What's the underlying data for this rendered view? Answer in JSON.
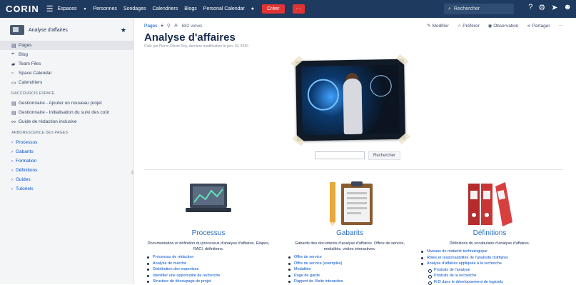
{
  "topbar": {
    "logo": "C RIN",
    "nav": [
      "Espaces",
      "Personnes",
      "Sondages",
      "Calendriers",
      "Blogs",
      "Personal Calendar"
    ],
    "create_label": "Créer",
    "more_label": "···",
    "search_placeholder": "Rechercher"
  },
  "sidebar": {
    "space_name": "Analyse d'affaires",
    "items": [
      {
        "label": "Pages",
        "icon": "page-icon"
      },
      {
        "label": "Blog",
        "icon": "quote-icon"
      },
      {
        "label": "Team Files",
        "icon": "folder-icon"
      },
      {
        "label": "Space Calendar",
        "icon": "calendar-icon"
      },
      {
        "label": "Calendriers",
        "icon": "calendar-icon"
      }
    ],
    "shortcuts_title": "RACCOURCIS ESPACE",
    "shortcuts": [
      "Gestionnaire - Ajouter un nouveau projet",
      "Gestionnaire - Initialisation du suivi des coût",
      "Guide de rédaction inclusive"
    ],
    "tree_title": "ARBORESCENCE DES PAGES",
    "tree": [
      "Processus",
      "Gabarits",
      "Formation",
      "Définitions",
      "Guides",
      "Tutoriels"
    ]
  },
  "page": {
    "breadcrumb": "Pages",
    "views": "682 views",
    "actions": [
      "Modifier",
      "Préférer",
      "Observation",
      "Partager",
      "···"
    ],
    "title": "Analyse d'affaires",
    "byline": "Créé par Pierre-Olivier Roy, dernière modification le janv 19, 2020",
    "search_button": "Rechercher"
  },
  "columns": [
    {
      "heading": "Processus",
      "desc": "Documentation et définition du processus d'analyse d'affaires. Étapes, RACI, définitions.",
      "links": [
        {
          "text": "Processus de rédaction"
        },
        {
          "text": "Analyse de marché"
        },
        {
          "text": "Distribution des expertises"
        },
        {
          "text": "Identifier une opportunité de recherche"
        },
        {
          "text": "Structure de découpage de projet"
        }
      ]
    },
    {
      "heading": "Gabarits",
      "desc": "Gabarits des documents d'analyse d'affaires. Offres de service, modalités, visites interactives.",
      "links": [
        {
          "text": "Offre de service"
        },
        {
          "text": "Offre de service (exemples)"
        },
        {
          "text": "Modalités"
        },
        {
          "text": "Page de garde"
        },
        {
          "text": "Rapport de Visite interactive"
        }
      ]
    },
    {
      "heading": "Définitions",
      "desc": "Définitions du vocabulaire d'analyse d'affaires.",
      "links": [
        {
          "text": "Niveaux de maturité technologique"
        },
        {
          "text": "Rôles et responsabilités de l'analyste d'affaires"
        },
        {
          "text": "Analyse d'affaires appliquée à la recherche"
        },
        {
          "text": "Produits de l'analyse",
          "sub": true
        },
        {
          "text": "Produits de la recherche",
          "sub": true
        },
        {
          "text": "R-D dans le développement de logiciels",
          "sub": true
        }
      ]
    }
  ]
}
